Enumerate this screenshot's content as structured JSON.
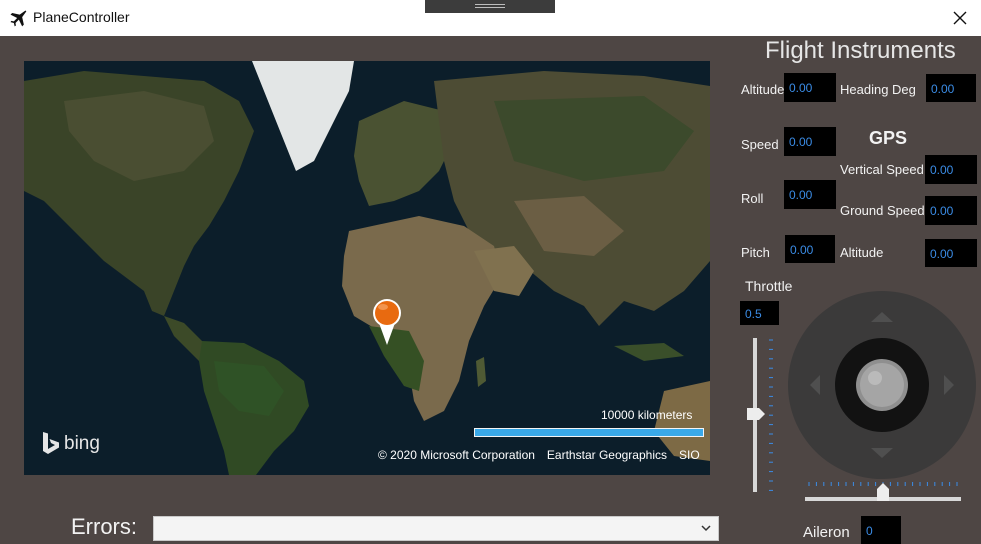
{
  "window": {
    "title": "PlaneController",
    "icon": "airplane-icon",
    "close_icon": "close-icon"
  },
  "map": {
    "logo_text": "bing",
    "scale_label": "10000 kilometers",
    "copyright": [
      "© 2020 Microsoft Corporation",
      "Earthstar Geographics",
      "SIO"
    ],
    "pin_icon": "map-pin-icon"
  },
  "errors": {
    "label": "Errors:",
    "selected": ""
  },
  "instruments": {
    "title": "Flight Instruments",
    "altitude": {
      "label": "Altitude",
      "value": "0.00"
    },
    "speed": {
      "label": "Speed",
      "value": "0.00"
    },
    "roll": {
      "label": "Roll",
      "value": "0.00"
    },
    "pitch": {
      "label": "Pitch",
      "value": "0.00"
    },
    "heading": {
      "label": "Heading Deg",
      "value": "0.00"
    }
  },
  "gps": {
    "title": "GPS",
    "vertical_speed": {
      "label": "Vertical Speed",
      "value": "0.00"
    },
    "ground_speed": {
      "label": "Ground Speed",
      "value": "0.00"
    },
    "altitude": {
      "label": "Altitude",
      "value": "0.00"
    }
  },
  "throttle": {
    "label": "Throttle",
    "value": "0.5",
    "level": 0.5
  },
  "aileron": {
    "label": "Aileron",
    "value": "0",
    "level": 0.5
  },
  "colors": {
    "background": "#4e4644",
    "value_text": "#3b8ce6",
    "pin": "#e86a10",
    "scale_bar": "#3aa9e8"
  }
}
